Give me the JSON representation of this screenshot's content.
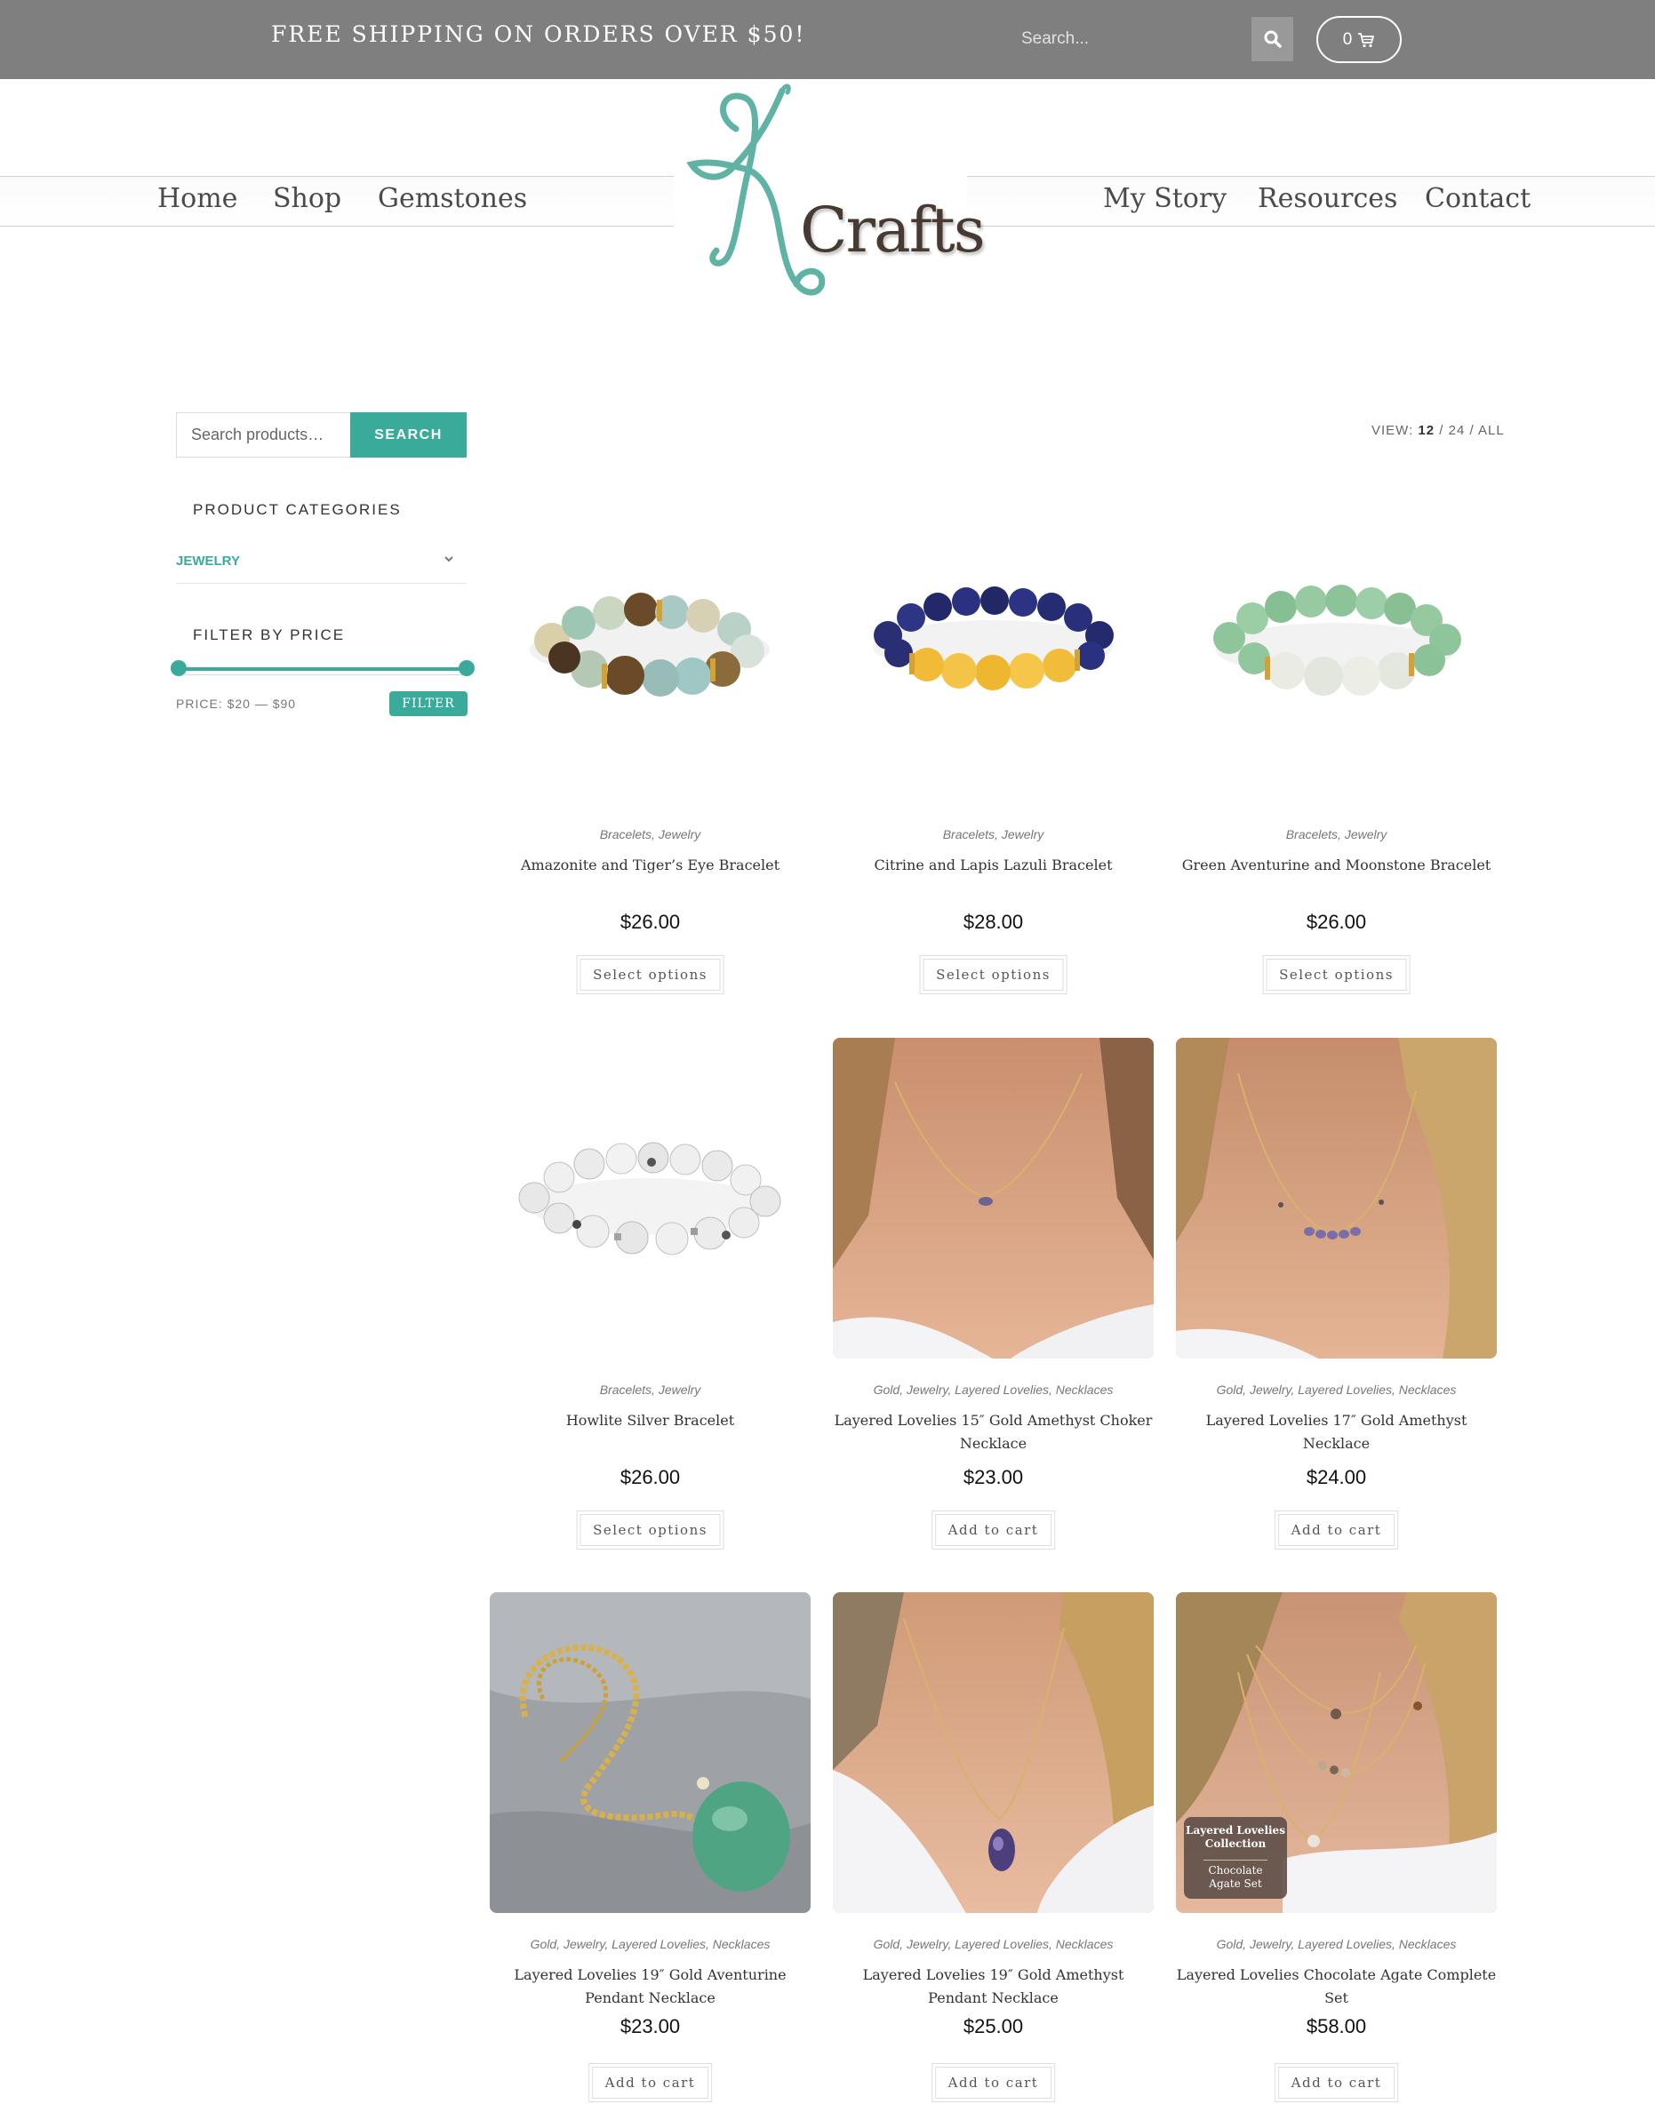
{
  "topbar": {
    "promo": "FREE SHIPPING ON ORDERS OVER $50!",
    "search_placeholder": "Search...",
    "cart_count": "0"
  },
  "brand": {
    "name": "Crafts",
    "initial": "K",
    "accent": "#5fb2a4",
    "text_color": "#463a33"
  },
  "nav": {
    "left": [
      "Home",
      "Shop",
      "Gemstones"
    ],
    "right": [
      "My Story",
      "Resources",
      "Contact"
    ]
  },
  "sidebar": {
    "search_placeholder": "Search products…",
    "search_button": "SEARCH",
    "categories_title": "PRODUCT CATEGORIES",
    "category": "JEWELRY",
    "price_title": "FILTER BY PRICE",
    "price_range": {
      "min": 20,
      "max": 90
    },
    "price_text": "PRICE: $20 — $90",
    "filter_button": "FILTER"
  },
  "view": {
    "label": "VIEW:",
    "current": "12",
    "sep1": "/",
    "opt2": "24",
    "sep2": "/",
    "opt3": "ALL"
  },
  "colors": {
    "accent": "#3aab9b",
    "topbar": "#7f7f7f"
  },
  "products": [
    {
      "cats": "Bracelets, Jewelry",
      "title": "Amazonite and Tiger’s Eye Bracelet",
      "price": "$26.00",
      "button": "Select options",
      "image": "bracelet-amazonite"
    },
    {
      "cats": "Bracelets, Jewelry",
      "title": "Citrine and Lapis Lazuli Bracelet",
      "price": "$28.00",
      "button": "Select options",
      "image": "bracelet-citrine-lapis"
    },
    {
      "cats": "Bracelets, Jewelry",
      "title": "Green Aventurine and Moonstone Bracelet",
      "price": "$26.00",
      "button": "Select options",
      "image": "bracelet-aventurine-moonstone"
    },
    {
      "cats": "Bracelets, Jewelry",
      "title": "Howlite Silver Bracelet",
      "price": "$26.00",
      "button": "Select options",
      "image": "bracelet-howlite"
    },
    {
      "cats": "Gold, Jewelry, Layered Lovelies, Necklaces",
      "title": "Layered Lovelies 15″ Gold Amethyst Choker Necklace",
      "price": "$23.00",
      "button": "Add to cart",
      "image": "necklace-choker-photo"
    },
    {
      "cats": "Gold, Jewelry, Layered Lovelies, Necklaces",
      "title": "Layered Lovelies 17″ Gold Amethyst Necklace",
      "price": "$24.00",
      "button": "Add to cart",
      "image": "necklace-17-photo"
    },
    {
      "cats": "Gold, Jewelry, Layered Lovelies, Necklaces",
      "title": "Layered Lovelies 19″ Gold Aventurine Pendant Necklace",
      "price": "$23.00",
      "button": "Add to cart",
      "image": "necklace-aventurine-photo"
    },
    {
      "cats": "Gold, Jewelry, Layered Lovelies, Necklaces",
      "title": "Layered Lovelies 19″ Gold Amethyst Pendant Necklace",
      "price": "$25.00",
      "button": "Add to cart",
      "image": "necklace-amethyst-pendant-photo"
    },
    {
      "cats": "Gold, Jewelry, Layered Lovelies, Necklaces",
      "title": "Layered Lovelies Chocolate Agate Complete Set",
      "price": "$58.00",
      "button": "Add to cart",
      "image": "necklace-set-photo",
      "badge": {
        "line1": "Layered Lovelies Collection",
        "line2": "Chocolate Agate Set"
      }
    }
  ]
}
